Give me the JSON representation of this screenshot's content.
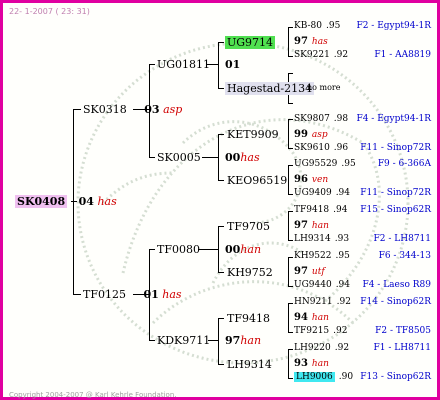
{
  "header": "22- 1-2007 ( 23: 31)",
  "footer": "Copyright 2004-2007 @ Karl Kehrle Foundation.",
  "root": {
    "name": "SK0408",
    "gen": "04",
    "note": "has"
  },
  "gen1": [
    {
      "name": "SK0318",
      "gen": "03",
      "note": "asp"
    },
    {
      "name": "TF0125",
      "gen": "01",
      "note": "has"
    }
  ],
  "gen2": [
    {
      "name": "UG01811"
    },
    {
      "name": "SK0005"
    },
    {
      "name": "TF0080"
    },
    {
      "name": "KDK9711"
    }
  ],
  "gen3": [
    {
      "name": "UG9714",
      "gen": "01",
      "note": ""
    },
    {
      "name": "Hagestad-2134",
      "gen": "",
      "note": ""
    },
    {
      "name": "KET9909",
      "gen": "00",
      "note": "has"
    },
    {
      "name": "KEO96519",
      "gen": "",
      "note": ""
    },
    {
      "name": "TF9705",
      "gen": "00",
      "note": "han"
    },
    {
      "name": "KH9752",
      "gen": "",
      "note": ""
    },
    {
      "name": "TF9418",
      "gen": "",
      "note": ""
    },
    {
      "name": "LH9314",
      "gen": "97",
      "note": "han"
    }
  ],
  "gen4": [
    {
      "name": "KB-80",
      "year": ".95",
      "ref": "F2 - Egypt94-1R"
    },
    {
      "name": "97",
      "year": "",
      "note": "has",
      "ref": ""
    },
    {
      "name": "SK9221",
      "year": ".92",
      "ref": "F1 - AA8819"
    },
    {
      "name": "no more",
      "year": "",
      "ref": ""
    },
    {
      "name": "SK9807",
      "year": ".98",
      "ref": "F4 - Egypt94-1R"
    },
    {
      "name": "99",
      "year": "",
      "note": "asp",
      "ref": ""
    },
    {
      "name": "SK9610",
      "year": ".96",
      "ref": "F11 - Sinop72R"
    },
    {
      "name": "UG95529",
      "year": ".95",
      "ref": "F9 - 6-366A"
    },
    {
      "name": "96",
      "year": "",
      "note": "ven",
      "ref": ""
    },
    {
      "name": "UG9409",
      "year": ".94",
      "ref": "F11 - Sinop72R"
    },
    {
      "name": "TF9418",
      "year": ".94",
      "ref": "F15 - Sinop62R"
    },
    {
      "name": "97",
      "year": "",
      "note": "han",
      "ref": ""
    },
    {
      "name": "LH9314",
      "year": ".93",
      "ref": "F2 - LH8711"
    },
    {
      "name": "KH9522",
      "year": ".95",
      "ref": "F6 - 344-13"
    },
    {
      "name": "97",
      "year": "",
      "note": "utf",
      "ref": ""
    },
    {
      "name": "UG9440",
      "year": ".94",
      "ref": "F4 - Laeso R89"
    },
    {
      "name": "HN9211",
      "year": ".92",
      "ref": "F14 - Sinop62R"
    },
    {
      "name": "94",
      "year": "",
      "note": "han",
      "ref": ""
    },
    {
      "name": "TF9215",
      "year": ".92",
      "ref": "F2 - TF8505"
    },
    {
      "name": "LH9220",
      "year": ".92",
      "ref": "F1 - LH8711"
    },
    {
      "name": "93",
      "year": "",
      "note": "han",
      "ref": ""
    },
    {
      "name": "LH9006",
      "year": ".90",
      "ref": "F13 - Sinop62R"
    }
  ]
}
